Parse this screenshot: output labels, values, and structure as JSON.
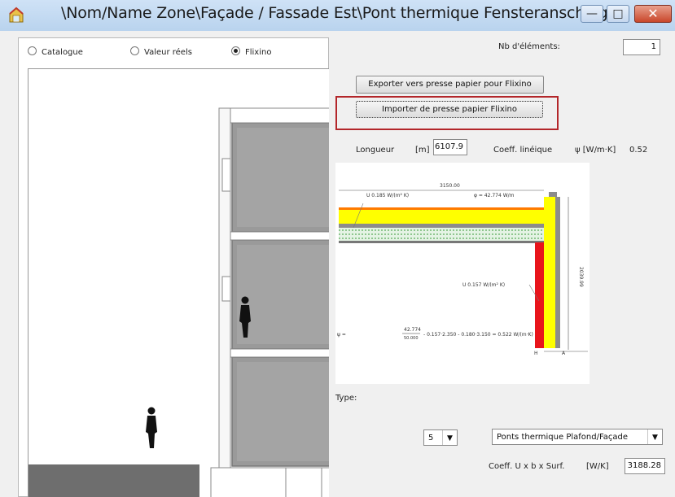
{
  "window": {
    "title": "\\Nom/Name Zone\\Façade / Fassade Est\\Pont thermique Fensteranschlag",
    "minimize_glyph": "—",
    "maximize_glyph": "□",
    "close_glyph": "✕"
  },
  "mode_radios": [
    {
      "label": "Catalogue",
      "selected": false
    },
    {
      "label": "Valeur réels",
      "selected": false
    },
    {
      "label": "Flixino",
      "selected": true
    }
  ],
  "elements": {
    "label": "Nb d'éléments:",
    "value": "1"
  },
  "buttons": {
    "export": "Exporter vers presse papier pour Flixino",
    "import": "Importer de presse papier Flixino"
  },
  "length": {
    "label": "Longueur",
    "unit": "[m]",
    "value": "6107.9"
  },
  "linear_coeff": {
    "label": "Coeff. linéique",
    "unit": "ψ [W/m·K]",
    "value": "0.52"
  },
  "detail_drawing": {
    "dimension_top": "3150.00",
    "u_top": "U   0.185 W/(m² K)",
    "phi": "φ    = 42.774 W/m",
    "u_wall": "U   0.157 W/(m² K)",
    "dimension_side": "2039.99",
    "formula_lhs": "ψ     =",
    "formula_frac_num": "42.774",
    "formula_frac_den": "50.000",
    "formula_rest": "- 0.157·2.350 - 0.180·3.150 = 0.522 W/(m·K)",
    "mark_h": "H",
    "mark_a": "A"
  },
  "type": {
    "label": "Type:"
  },
  "type_number": {
    "value": "5"
  },
  "type_select": {
    "value": "Ponts thermique Plafond/Façade"
  },
  "coeff_total": {
    "label": "Coeff. U x b x Surf.",
    "unit": "[W/K]",
    "value": "3188.28"
  },
  "colors": {
    "titlebar": "#cfe2f6",
    "close_button": "#c9472b",
    "insulation_yellow": "#ffff00",
    "concrete_grey": "#8c8c8c",
    "hot_red": "#e8141b",
    "highlight": "#b3262a"
  }
}
